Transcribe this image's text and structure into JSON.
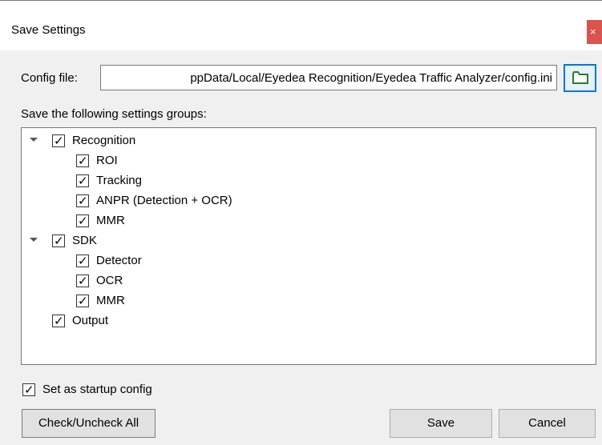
{
  "window": {
    "title": "Save Settings",
    "close_glyph": "×"
  },
  "config": {
    "label": "Config file:",
    "value": "ppData/Local/Eyedea Recognition/Eyedea Traffic Analyzer/config.ini",
    "browse_icon": "folder-icon"
  },
  "groups_label": "Save the following settings groups:",
  "tree": [
    {
      "label": "Recognition",
      "checked": true,
      "expanded": true
    },
    {
      "label": "ROI",
      "checked": true
    },
    {
      "label": "Tracking",
      "checked": true
    },
    {
      "label": "ANPR (Detection + OCR)",
      "checked": true
    },
    {
      "label": "MMR",
      "checked": true
    },
    {
      "label": "SDK",
      "checked": true,
      "expanded": true
    },
    {
      "label": "Detector",
      "checked": true
    },
    {
      "label": "OCR",
      "checked": true
    },
    {
      "label": "MMR",
      "checked": true
    },
    {
      "label": "Output",
      "checked": true
    }
  ],
  "startup": {
    "label": "Set as startup config",
    "checked": true
  },
  "buttons": {
    "check_all": "Check/Uncheck All",
    "save": "Save",
    "cancel": "Cancel"
  }
}
